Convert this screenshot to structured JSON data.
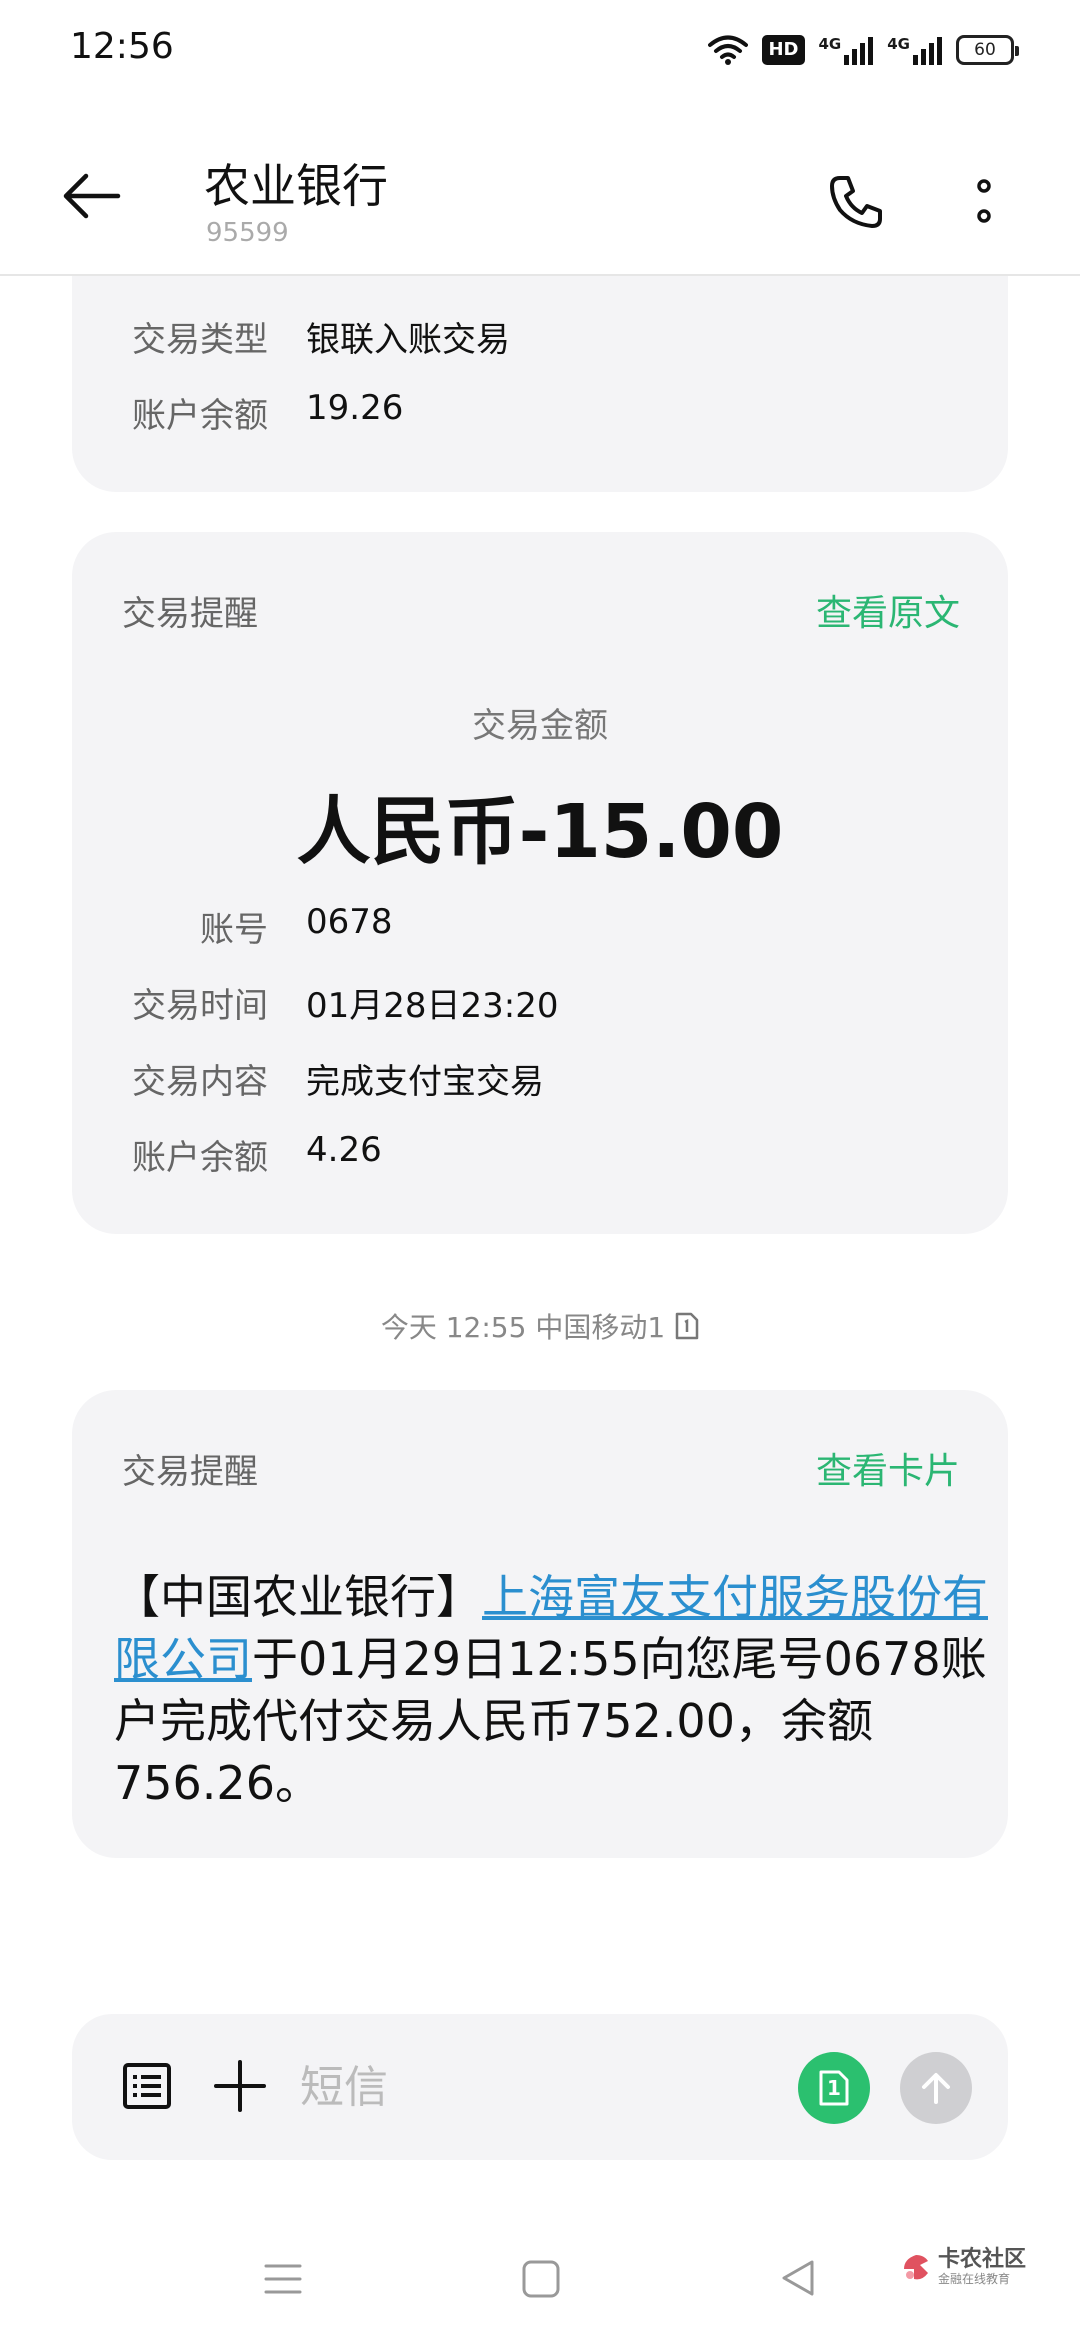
{
  "status_bar": {
    "time": "12:56",
    "hd_label": "HD",
    "net1_label": "4G",
    "net2_label": "4G",
    "battery": "60"
  },
  "header": {
    "title": "农业银行",
    "subtitle": "95599",
    "icons": [
      "back-arrow-icon",
      "phone-icon",
      "more-vert-icon"
    ]
  },
  "card_partial": {
    "rows": [
      {
        "label": "交易类型",
        "value": "银联入账交易"
      },
      {
        "label": "账户余额",
        "value": "19.26"
      }
    ]
  },
  "card_transaction": {
    "header": "交易提醒",
    "link": "查看原文",
    "amount_label": "交易金额",
    "amount_value": "人民币-15.00",
    "rows": [
      {
        "label": "账号",
        "value": "0678"
      },
      {
        "label": "交易时间",
        "value": "01月28日23:20"
      },
      {
        "label": "交易内容",
        "value": "完成支付宝交易"
      },
      {
        "label": "账户余额",
        "value": "4.26"
      }
    ]
  },
  "timestamp": {
    "text": "今天 12:55  中国移动1",
    "icon": "sim-card-icon"
  },
  "card_message": {
    "header": "交易提醒",
    "link": "查看卡片",
    "body_prefix": "【中国农业银行】",
    "body_link": "上海富友支付服务股份有限公司",
    "body_suffix": "于01月29日12:55向您尾号0678账户完成代付交易人民币752.00，余额756.26。"
  },
  "composer": {
    "placeholder": "短信",
    "sim_label": "1",
    "accent_color": "#2bc06f"
  },
  "watermark": {
    "main": "卡农社区",
    "sub": "金融在线教育"
  },
  "colors": {
    "accent_green": "#2bb673",
    "link_blue": "#2b8fcf",
    "card_bg": "#f4f4f6"
  }
}
